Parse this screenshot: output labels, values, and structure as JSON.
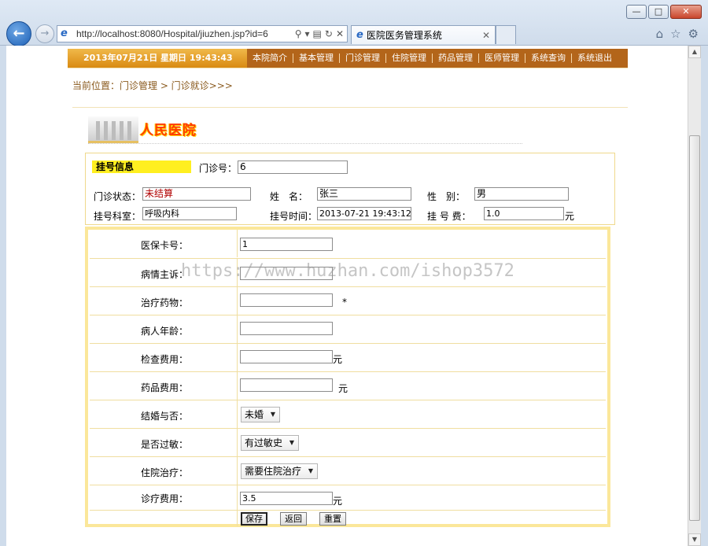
{
  "browser": {
    "url": "http://localhost:8080/Hospital/jiuzhen.jsp?id=6",
    "tab_title": "医院医务管理系统",
    "win_min": "—",
    "win_max": "□",
    "win_close": "✕",
    "back_glyph": "←",
    "fwd_glyph": "→",
    "tab_close": "✕"
  },
  "header": {
    "datetime": "2013年07月21日 星期日 19:43:43",
    "menu": [
      "本院简介",
      "基本管理",
      "门诊管理",
      "住院管理",
      "药品管理",
      "医师管理",
      "系统查询",
      "系统退出"
    ]
  },
  "breadcrumb": "当前位置：门诊管理 > 门诊就诊>>>",
  "logo_text": "人民医院",
  "info": {
    "title": "挂号信息",
    "clinic_no_label": "门诊号：",
    "clinic_no": "6",
    "status_label": "门诊状态：",
    "status": "未结算",
    "name_label": "姓　名：",
    "name": "张三",
    "gender_label": "性　别：",
    "gender": "男",
    "dept_label": "挂号科室：",
    "dept": "呼吸内科",
    "reg_time_label": "挂号时间：",
    "reg_time": "2013-07-21 19:43:12",
    "fee_label": "挂 号 费：",
    "fee": "1.0",
    "fee_unit": "元"
  },
  "form": {
    "insurance_label": "医保卡号：",
    "insurance_value": "1",
    "complaint_label": "病情主诉：",
    "complaint_value": "",
    "drugs_label": "治疗药物：",
    "drugs_value": "",
    "required_mark": "*",
    "age_label": "病人年龄：",
    "age_value": "",
    "exam_fee_label": "检查费用：",
    "exam_fee_value": "",
    "yuan": "元",
    "drug_fee_label": "药品费用：",
    "drug_fee_value": "",
    "married_label": "结婚与否：",
    "married_value": "未婚",
    "allergy_label": "是否过敏：",
    "allergy_value": "有过敏史",
    "hospitalize_label": "住院治疗：",
    "hospitalize_value": "需要住院治疗",
    "diag_fee_label": "诊疗费用：",
    "diag_fee_value": "3.5",
    "save": "保存",
    "back": "返回",
    "reset": "重置"
  },
  "watermark": "https://www.huzhan.com/ishop3572"
}
